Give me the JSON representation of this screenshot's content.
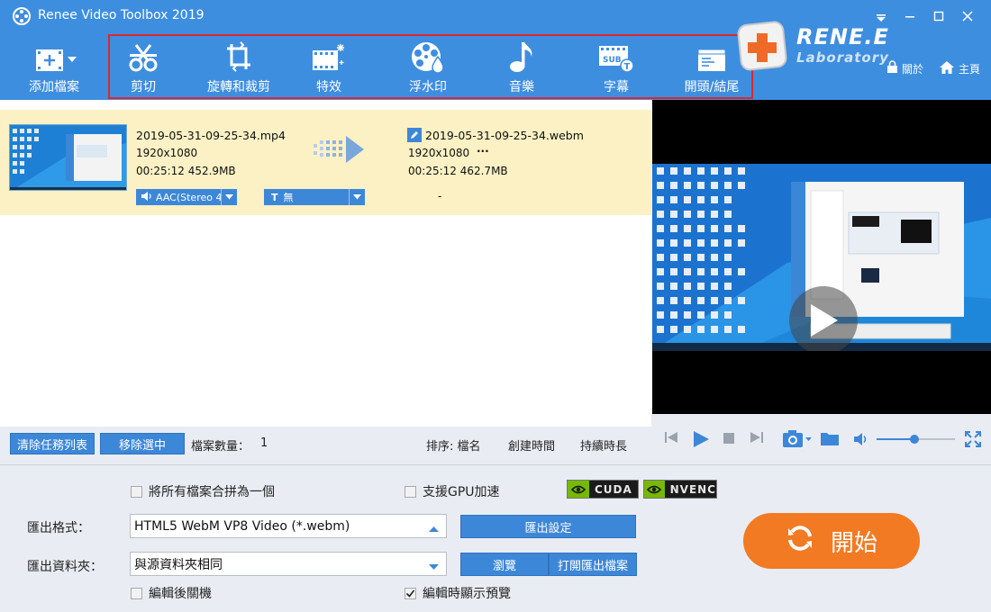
{
  "app": {
    "title": "Renee Video Toolbox 2019"
  },
  "toolbar": {
    "add_file": "添加檔案",
    "items": [
      {
        "label": "剪切",
        "icon": "scissors-icon"
      },
      {
        "label": "旋轉和裁剪",
        "icon": "crop-rotate-icon"
      },
      {
        "label": "特效",
        "icon": "effects-film-icon"
      },
      {
        "label": "浮水印",
        "icon": "watermark-icon"
      },
      {
        "label": "音樂",
        "icon": "music-note-icon"
      },
      {
        "label": "字幕",
        "icon": "subtitle-icon"
      },
      {
        "label": "開頭/結尾",
        "icon": "intro-outro-icon"
      }
    ]
  },
  "brand": {
    "name": "RENE.E",
    "sub": "Laboratory"
  },
  "header_links": {
    "about": "關於",
    "home": "主頁"
  },
  "file": {
    "src_name": "2019-05-31-09-25-34.mp4",
    "src_res": "1920x1080",
    "src_info": "00:25:12  452.9MB",
    "dst_name": "2019-05-31-09-25-34.webm",
    "dst_res": "1920x1080",
    "dst_more": "···",
    "dst_info": "00:25:12  462.7MB",
    "audio": "AAC(Stereo 4",
    "subtitle": "無",
    "subtitle_glyph": "T",
    "dash": "-"
  },
  "list_toolbar": {
    "clear": "清除任務列表",
    "remove": "移除選中",
    "count_label": "檔案數量：",
    "count": "1",
    "sort": "排序: 檔名",
    "created": "創建時間",
    "duration": "持續時長"
  },
  "settings": {
    "merge": "將所有檔案合拼為一個",
    "gpu": "支援GPU加速",
    "cuda": "CUDA",
    "nvenc": "NVENC",
    "format_label": "匯出格式：",
    "format_value": "HTML5 WebM VP8 Video (*.webm)",
    "export_settings": "匯出設定",
    "folder_label": "匯出資料夾：",
    "folder_value": "與源資料夾相同",
    "browse": "瀏覽",
    "open_folder": "打開匯出檔案",
    "shutdown": "編輯後關機",
    "show_preview": "編輯時顯示預覽",
    "start": "開始"
  },
  "colors": {
    "header": "#3e8ee0",
    "accent_button": "#3d87d8",
    "start": "#f27a23",
    "row_highlight": "#fbf1c4",
    "toolbar_border": "#e0262c"
  }
}
